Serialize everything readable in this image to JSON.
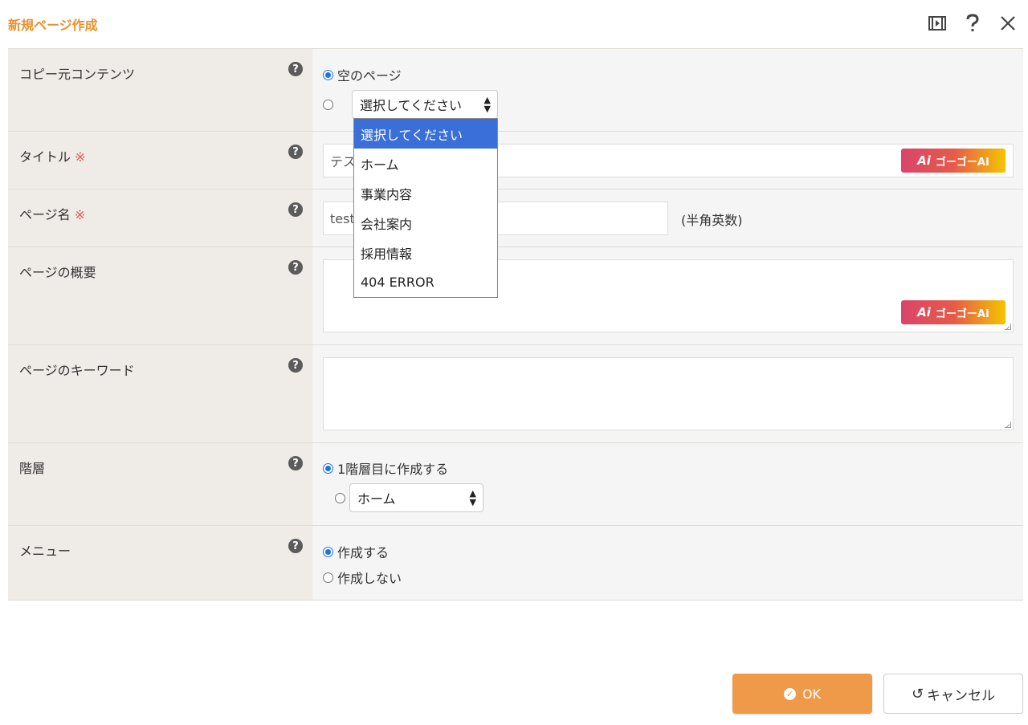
{
  "header": {
    "title": "新規ページ作成",
    "icons": [
      "film-icon",
      "question-icon",
      "close-icon"
    ]
  },
  "form": {
    "copy_source": {
      "label": "コピー元コンテンツ",
      "option_blank": "空のページ",
      "select_value": "選択してください",
      "blank_selected": true
    },
    "title_row": {
      "label": "タイトル",
      "required_mark": "※",
      "value": "テス",
      "ai_label": "ゴーゴーAI"
    },
    "page_name": {
      "label": "ページ名",
      "required_mark": "※",
      "value": "test",
      "hint": "(半角英数)"
    },
    "summary": {
      "label": "ページの概要",
      "ai_label": "ゴーゴーAI"
    },
    "keywords": {
      "label": "ページのキーワード"
    },
    "hierarchy": {
      "label": "階層",
      "option_first": "1階層目に作成する",
      "select_value": "ホーム"
    },
    "menu": {
      "label": "メニュー",
      "option_create": "作成する",
      "option_no_create": "作成しない"
    }
  },
  "dropdown": {
    "items": [
      "選択してください",
      "ホーム",
      "事業内容",
      "会社案内",
      "採用情報",
      "404 ERROR"
    ],
    "active_index": 0
  },
  "buttons": {
    "ok": "OK",
    "cancel": "キャンセル"
  },
  "colors": {
    "accent": "#e8912e",
    "ok_button": "#ee9a48",
    "dropdown_active": "#3a6fd8",
    "label_bg": "#efebe6"
  }
}
